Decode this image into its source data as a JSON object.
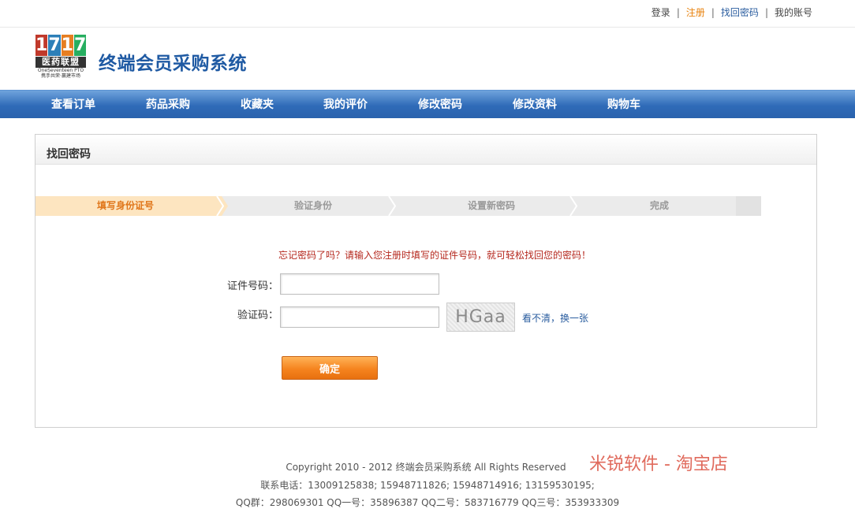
{
  "toplinks": {
    "login": "登录",
    "sep": "|",
    "register": "注册",
    "find_password": "找回密码",
    "my_account": "我的账号"
  },
  "logo": {
    "digits": [
      "1",
      "7",
      "1",
      "7"
    ],
    "cn": "医药联盟",
    "en": "OneSeventeen PTO",
    "tagline": "携手共荣·赢建市场"
  },
  "header": {
    "title": "终端会员采购系统"
  },
  "nav": {
    "items": [
      "查看订单",
      "药品采购",
      "收藏夹",
      "我的评价",
      "修改密码",
      "修改资料",
      "购物车"
    ]
  },
  "panel": {
    "title": "找回密码",
    "steps": [
      "填写身份证号",
      "验证身份",
      "设置新密码",
      "完成"
    ],
    "active_step": 0,
    "hint": "忘记密码了吗？请输入您注册时填写的证件号码，就可轻松找回您的密码！",
    "id_label": "证件号码：",
    "id_value": "",
    "code_label": "验证码：",
    "code_value": "",
    "captcha_text": "HGaa",
    "change_prefix": "看不清，",
    "change_link": "换一张",
    "submit": "确定"
  },
  "footer": {
    "copyright": "Copyright 2010 - 2012 终端会员采购系统 All Rights Reserved",
    "phones": "联系电话：13009125838; 15948711826; 15948714916; 13159530195;",
    "qq": "QQ群：298069301 QQ一号：35896387 QQ二号：583716779 QQ三号：353933309",
    "watermark": "米锐软件 - 淘宝店"
  },
  "colors": {
    "nav": "#2f6bb8",
    "title": "#1f5aa3",
    "accent": "#f5841f",
    "hint": "#b5281e",
    "link": "#2a5d9f"
  }
}
